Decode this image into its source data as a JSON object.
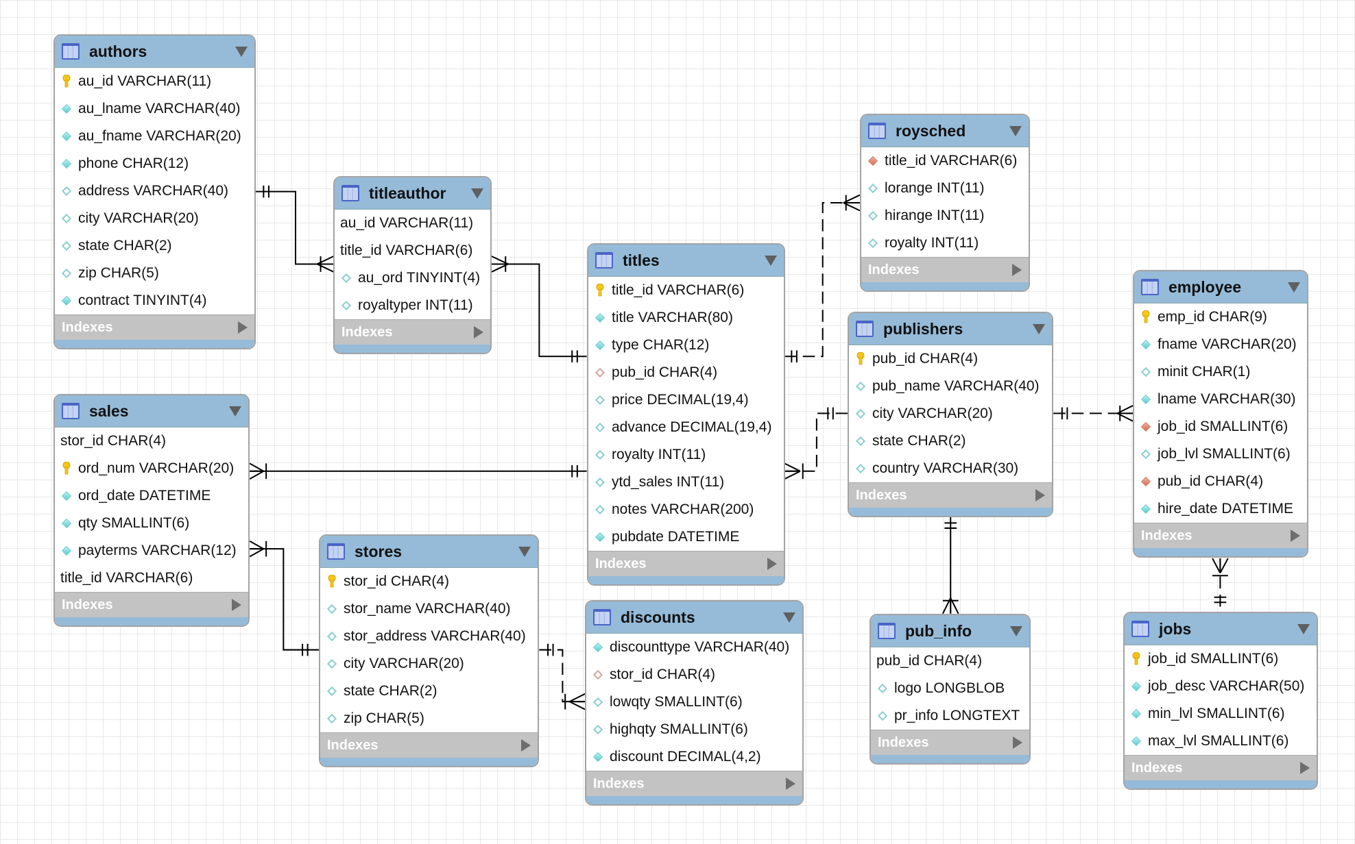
{
  "indexes_label": "Indexes",
  "colors": {
    "header": "#95bbd8",
    "indexes_bar": "#c3c3c3",
    "key": "#f5c518",
    "not_null": "#5cc8cc",
    "fk": "#d66a55"
  },
  "tables": {
    "authors": {
      "name": "authors",
      "columns": [
        {
          "text": "au_id VARCHAR(11)",
          "icon": "key"
        },
        {
          "text": "au_lname VARCHAR(40)",
          "icon": "not-null"
        },
        {
          "text": "au_fname VARCHAR(20)",
          "icon": "not-null"
        },
        {
          "text": "phone CHAR(12)",
          "icon": "not-null"
        },
        {
          "text": "address VARCHAR(40)",
          "icon": "nullable"
        },
        {
          "text": "city VARCHAR(20)",
          "icon": "nullable"
        },
        {
          "text": "state CHAR(2)",
          "icon": "nullable"
        },
        {
          "text": "zip CHAR(5)",
          "icon": "nullable"
        },
        {
          "text": "contract TINYINT(4)",
          "icon": "not-null"
        }
      ]
    },
    "titleauthor": {
      "name": "titleauthor",
      "columns": [
        {
          "text": "au_id VARCHAR(11)",
          "icon": "none"
        },
        {
          "text": "title_id VARCHAR(6)",
          "icon": "none"
        },
        {
          "text": "au_ord TINYINT(4)",
          "icon": "nullable"
        },
        {
          "text": "royaltyper INT(11)",
          "icon": "nullable"
        }
      ]
    },
    "titles": {
      "name": "titles",
      "columns": [
        {
          "text": "title_id VARCHAR(6)",
          "icon": "key"
        },
        {
          "text": "title VARCHAR(80)",
          "icon": "not-null"
        },
        {
          "text": "type CHAR(12)",
          "icon": "not-null"
        },
        {
          "text": "pub_id CHAR(4)",
          "icon": "fk-nullable"
        },
        {
          "text": "price DECIMAL(19,4)",
          "icon": "nullable"
        },
        {
          "text": "advance DECIMAL(19,4)",
          "icon": "nullable"
        },
        {
          "text": "royalty INT(11)",
          "icon": "nullable"
        },
        {
          "text": "ytd_sales INT(11)",
          "icon": "nullable"
        },
        {
          "text": "notes VARCHAR(200)",
          "icon": "nullable"
        },
        {
          "text": "pubdate DATETIME",
          "icon": "not-null"
        }
      ]
    },
    "roysched": {
      "name": "roysched",
      "columns": [
        {
          "text": "title_id VARCHAR(6)",
          "icon": "fk"
        },
        {
          "text": "lorange INT(11)",
          "icon": "nullable"
        },
        {
          "text": "hirange INT(11)",
          "icon": "nullable"
        },
        {
          "text": "royalty INT(11)",
          "icon": "nullable"
        }
      ]
    },
    "publishers": {
      "name": "publishers",
      "columns": [
        {
          "text": "pub_id CHAR(4)",
          "icon": "key"
        },
        {
          "text": "pub_name VARCHAR(40)",
          "icon": "nullable"
        },
        {
          "text": "city VARCHAR(20)",
          "icon": "nullable"
        },
        {
          "text": "state CHAR(2)",
          "icon": "nullable"
        },
        {
          "text": "country VARCHAR(30)",
          "icon": "nullable"
        }
      ]
    },
    "employee": {
      "name": "employee",
      "columns": [
        {
          "text": "emp_id CHAR(9)",
          "icon": "key"
        },
        {
          "text": "fname VARCHAR(20)",
          "icon": "not-null"
        },
        {
          "text": "minit CHAR(1)",
          "icon": "nullable"
        },
        {
          "text": "lname VARCHAR(30)",
          "icon": "not-null"
        },
        {
          "text": "job_id SMALLINT(6)",
          "icon": "fk"
        },
        {
          "text": "job_lvl SMALLINT(6)",
          "icon": "nullable"
        },
        {
          "text": "pub_id CHAR(4)",
          "icon": "fk"
        },
        {
          "text": "hire_date DATETIME",
          "icon": "not-null"
        }
      ]
    },
    "sales": {
      "name": "sales",
      "columns": [
        {
          "text": "stor_id CHAR(4)",
          "icon": "none"
        },
        {
          "text": "ord_num VARCHAR(20)",
          "icon": "key"
        },
        {
          "text": "ord_date DATETIME",
          "icon": "not-null"
        },
        {
          "text": "qty SMALLINT(6)",
          "icon": "not-null"
        },
        {
          "text": "payterms VARCHAR(12)",
          "icon": "not-null"
        },
        {
          "text": "title_id VARCHAR(6)",
          "icon": "none"
        }
      ]
    },
    "stores": {
      "name": "stores",
      "columns": [
        {
          "text": "stor_id CHAR(4)",
          "icon": "key"
        },
        {
          "text": "stor_name VARCHAR(40)",
          "icon": "nullable"
        },
        {
          "text": "stor_address VARCHAR(40)",
          "icon": "nullable"
        },
        {
          "text": "city VARCHAR(20)",
          "icon": "nullable"
        },
        {
          "text": "state CHAR(2)",
          "icon": "nullable"
        },
        {
          "text": "zip CHAR(5)",
          "icon": "nullable"
        }
      ]
    },
    "discounts": {
      "name": "discounts",
      "columns": [
        {
          "text": "discounttype VARCHAR(40)",
          "icon": "not-null"
        },
        {
          "text": "stor_id CHAR(4)",
          "icon": "fk-nullable"
        },
        {
          "text": "lowqty SMALLINT(6)",
          "icon": "nullable"
        },
        {
          "text": "highqty SMALLINT(6)",
          "icon": "nullable"
        },
        {
          "text": "discount DECIMAL(4,2)",
          "icon": "not-null"
        }
      ]
    },
    "pub_info": {
      "name": "pub_info",
      "columns": [
        {
          "text": "pub_id CHAR(4)",
          "icon": "none"
        },
        {
          "text": "logo LONGBLOB",
          "icon": "nullable"
        },
        {
          "text": "pr_info LONGTEXT",
          "icon": "nullable"
        }
      ]
    },
    "jobs": {
      "name": "jobs",
      "columns": [
        {
          "text": "job_id SMALLINT(6)",
          "icon": "key"
        },
        {
          "text": "job_desc VARCHAR(50)",
          "icon": "not-null"
        },
        {
          "text": "min_lvl SMALLINT(6)",
          "icon": "not-null"
        },
        {
          "text": "max_lvl SMALLINT(6)",
          "icon": "not-null"
        }
      ]
    }
  },
  "relationships": [
    {
      "from": "authors",
      "to": "titleauthor",
      "style": "identifying"
    },
    {
      "from": "titles",
      "to": "titleauthor",
      "style": "identifying"
    },
    {
      "from": "titles",
      "to": "roysched",
      "style": "non-identifying"
    },
    {
      "from": "publishers",
      "to": "titles",
      "style": "non-identifying"
    },
    {
      "from": "titles",
      "to": "sales",
      "style": "identifying"
    },
    {
      "from": "stores",
      "to": "sales",
      "style": "identifying"
    },
    {
      "from": "stores",
      "to": "discounts",
      "style": "non-identifying"
    },
    {
      "from": "publishers",
      "to": "pub_info",
      "style": "identifying"
    },
    {
      "from": "publishers",
      "to": "employee",
      "style": "non-identifying"
    },
    {
      "from": "jobs",
      "to": "employee",
      "style": "non-identifying"
    }
  ]
}
